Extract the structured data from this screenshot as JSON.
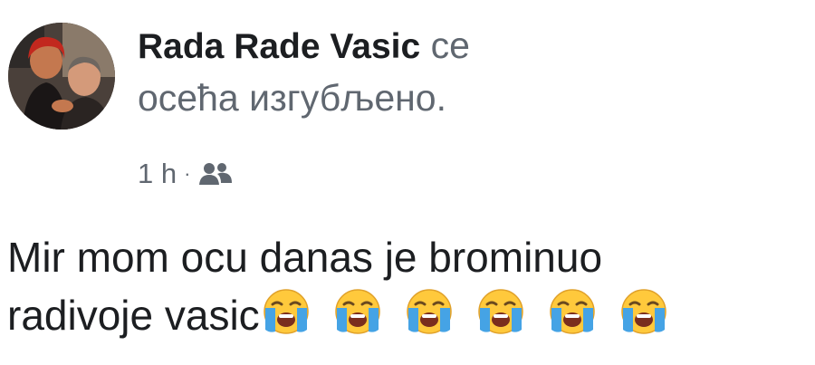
{
  "post": {
    "author": "Rada Rade Vasic",
    "feeling_line1": "се",
    "feeling_line2": "осећа изгубљено.",
    "timestamp": "1 h",
    "separator": "·",
    "audience_icon": "friends-icon",
    "avatar_icon": "profile-photo",
    "body_line1": "Mir mom ocu danas je brominuo",
    "body_line2": "radivoje vasic",
    "emojis": [
      "loudly-crying-face",
      "loudly-crying-face",
      "loudly-crying-face",
      "loudly-crying-face",
      "loudly-crying-face",
      "loudly-crying-face"
    ]
  },
  "colors": {
    "text_primary": "#1c1e21",
    "text_secondary": "#606770",
    "emoji_face": "#ffc93c",
    "emoji_tears": "#45a3e5"
  }
}
